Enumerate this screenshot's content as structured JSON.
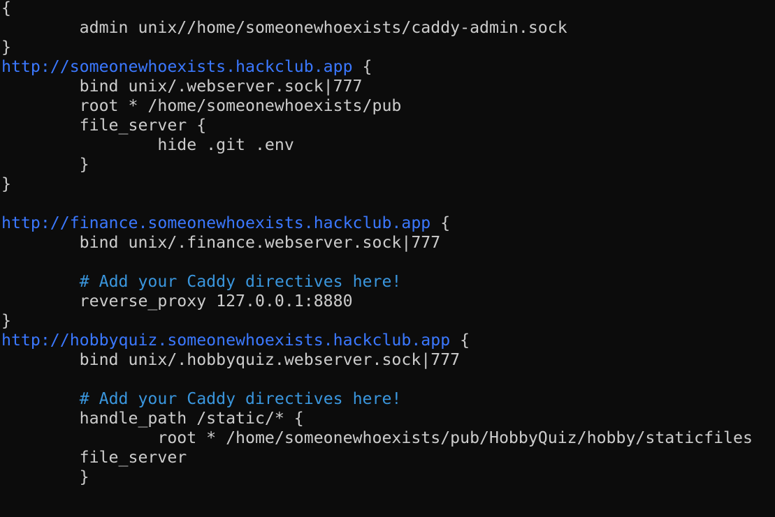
{
  "colors": {
    "background": "#0c0c0c",
    "text": "#cccccc",
    "url": "#3b78ff",
    "comment": "#3a96dd"
  },
  "lines": [
    [
      {
        "t": "text",
        "v": "{"
      }
    ],
    [
      {
        "t": "text",
        "v": "        admin unix//home/someonewhoexists/caddy-admin.sock"
      }
    ],
    [
      {
        "t": "text",
        "v": "}"
      }
    ],
    [
      {
        "t": "url",
        "v": "http://someonewhoexists.hackclub.app"
      },
      {
        "t": "text",
        "v": " {"
      }
    ],
    [
      {
        "t": "text",
        "v": "        bind unix/.webserver.sock|777"
      }
    ],
    [
      {
        "t": "text",
        "v": "        root * /home/someonewhoexists/pub"
      }
    ],
    [
      {
        "t": "text",
        "v": "        file_server {"
      }
    ],
    [
      {
        "t": "text",
        "v": "                hide .git .env"
      }
    ],
    [
      {
        "t": "text",
        "v": "        }"
      }
    ],
    [
      {
        "t": "text",
        "v": "}"
      }
    ],
    [],
    [
      {
        "t": "url",
        "v": "http://finance.someonewhoexists.hackclub.app"
      },
      {
        "t": "text",
        "v": " {"
      }
    ],
    [
      {
        "t": "text",
        "v": "        bind unix/.finance.webserver.sock|777"
      }
    ],
    [],
    [
      {
        "t": "text",
        "v": "        "
      },
      {
        "t": "comment",
        "v": "# Add your Caddy directives here!"
      }
    ],
    [
      {
        "t": "text",
        "v": "        reverse_proxy 127.0.0.1:8880"
      }
    ],
    [
      {
        "t": "text",
        "v": "}"
      }
    ],
    [
      {
        "t": "url",
        "v": "http://hobbyquiz.someonewhoexists.hackclub.app"
      },
      {
        "t": "text",
        "v": " {"
      }
    ],
    [
      {
        "t": "text",
        "v": "        bind unix/.hobbyquiz.webserver.sock|777"
      }
    ],
    [],
    [
      {
        "t": "text",
        "v": "        "
      },
      {
        "t": "comment",
        "v": "# Add your Caddy directives here!"
      }
    ],
    [
      {
        "t": "text",
        "v": "        handle_path /static/* {"
      }
    ],
    [
      {
        "t": "text",
        "v": "                root * /home/someonewhoexists/pub/HobbyQuiz/hobby/staticfiles"
      }
    ],
    [
      {
        "t": "text",
        "v": "        file_server"
      }
    ],
    [
      {
        "t": "text",
        "v": "        }"
      }
    ]
  ]
}
